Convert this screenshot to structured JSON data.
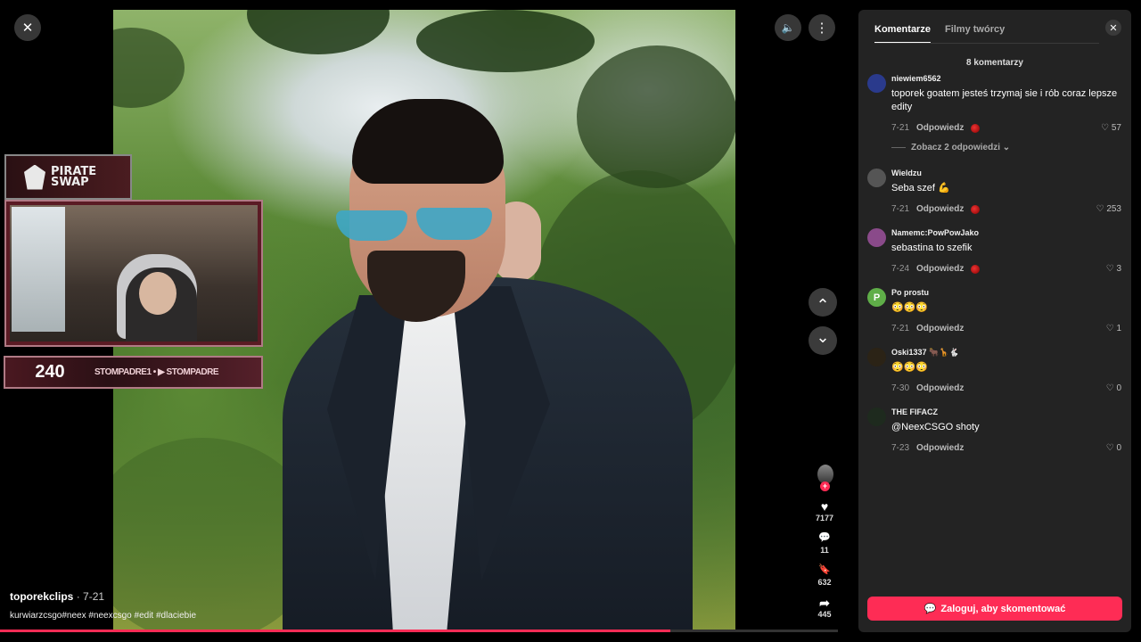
{
  "video": {
    "creator": "toporekclips",
    "date": "· 7-21",
    "caption": "kurwiarzcsgo#neex #neexcsgo #edit #dlaciebie",
    "overlay": {
      "brand": "PIRATE\nSWAP",
      "sub_count": "240",
      "handles": "STOMPADRE1 • ▶ STOMPADRE"
    },
    "progress": 0.8
  },
  "actions": {
    "likes": "7177",
    "comments": "11",
    "saves": "632",
    "shares": "445"
  },
  "icons": {
    "close": "✕",
    "volume": "🔈",
    "more": "⋮",
    "up": "⌃",
    "down": "⌄",
    "heart": "♥",
    "comment": "💬",
    "bookmark": "🔖",
    "share": "➦"
  },
  "comments_panel": {
    "tabs": [
      "Komentarze",
      "Filmy twórcy"
    ],
    "count_label": "8 komentarzy",
    "reply_label": "Odpowiedz",
    "see_replies": "Zobacz 2 odpowiedzi",
    "login_label": "Zaloguj, aby skomentować",
    "comments": [
      {
        "user": "niewiem6562",
        "text": "toporek goatem jesteś trzymaj sie i rób coraz lepsze edity",
        "date": "7-21",
        "likes": "57",
        "creator_liked": true,
        "avatar_color": "#2a3a8c",
        "avatar_letter": ""
      },
      {
        "user": "Wieldzu",
        "text": "Seba szef 💪",
        "date": "7-21",
        "likes": "253",
        "creator_liked": true,
        "avatar_color": "#555",
        "avatar_letter": ""
      },
      {
        "user": "Namemc:PowPowJako",
        "text": "sebastina to szefik",
        "date": "7-24",
        "likes": "3",
        "creator_liked": true,
        "avatar_color": "#8a4a8a",
        "avatar_letter": ""
      },
      {
        "user": "Po prostu",
        "text": "😳😳😳",
        "date": "7-21",
        "likes": "1",
        "creator_liked": false,
        "avatar_color": "#5fae48",
        "avatar_letter": "P"
      },
      {
        "user": "Oski1337 🐂🦒🐇",
        "text": "😳😳😳",
        "date": "7-30",
        "likes": "0",
        "creator_liked": false,
        "avatar_color": "#2b2316",
        "avatar_letter": ""
      },
      {
        "user": "THE FIFACZ",
        "text": "@NeexCSGO shoty",
        "date": "7-23",
        "likes": "0",
        "creator_liked": false,
        "avatar_color": "#1e2a1e",
        "avatar_letter": ""
      }
    ]
  }
}
